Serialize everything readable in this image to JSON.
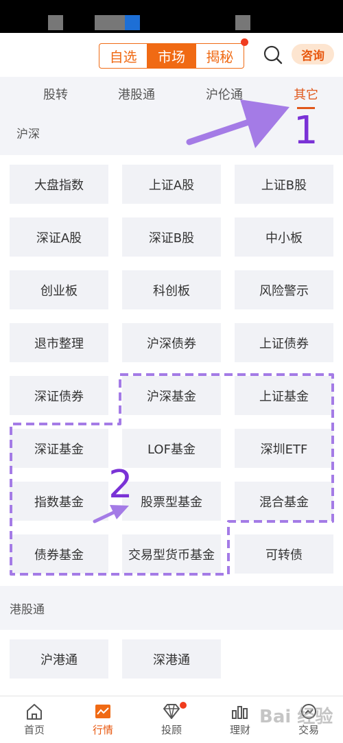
{
  "header": {
    "segments": [
      "自选",
      "市场",
      "揭秘"
    ],
    "active_segment": "市场",
    "consult_label": "咨询"
  },
  "tabs": [
    "股转",
    "港股通",
    "沪伦通",
    "其它"
  ],
  "active_tab": "其它",
  "sections": [
    {
      "title": "沪深",
      "items": [
        "大盘指数",
        "上证A股",
        "上证B股",
        "深证A股",
        "深证B股",
        "中小板",
        "创业板",
        "科创板",
        "风险警示",
        "退市整理",
        "沪深债券",
        "上证债券",
        "深证债券",
        "沪深基金",
        "上证基金",
        "深证基金",
        "LOF基金",
        "深圳ETF",
        "指数基金",
        "股票型基金",
        "混合基金",
        "债券基金",
        "交易型货币基金",
        "可转债"
      ]
    },
    {
      "title": "港股通",
      "items": [
        "沪港通",
        "深港通"
      ]
    }
  ],
  "bottom_nav": [
    "首页",
    "行情",
    "投顾",
    "理财",
    "交易"
  ],
  "active_nav": "行情",
  "annotations": {
    "label_1": "1",
    "label_2": "2"
  },
  "watermark": "Bai 经验",
  "colors": {
    "accent": "#f06a14",
    "annotation": "#a47be6",
    "annotation_text": "#7a32d6"
  }
}
